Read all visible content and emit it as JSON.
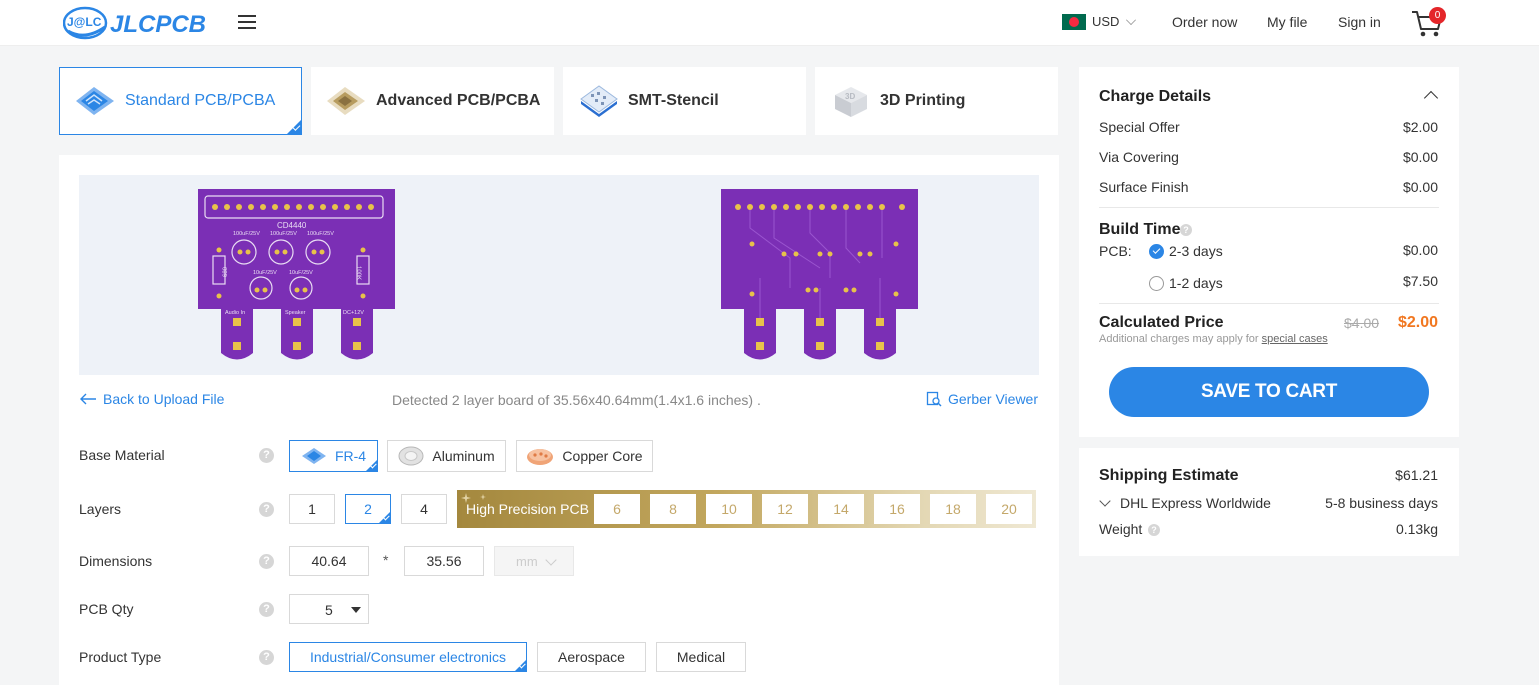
{
  "header": {
    "logo_badge": "J@LC",
    "logo_text": "JLCPCB",
    "currency": "USD",
    "nav": {
      "order_now": "Order now",
      "my_file": "My file",
      "sign_in": "Sign in"
    },
    "cart_count": "0"
  },
  "product_tabs": [
    {
      "label": "Standard PCB/PCBA",
      "active": true
    },
    {
      "label": "Advanced PCB/PCBA",
      "active": false
    },
    {
      "label": "SMT-Stencil",
      "active": false
    },
    {
      "label": "3D Printing",
      "active": false
    }
  ],
  "preview": {
    "top_labels": [
      "CD4440",
      "100uF/25V",
      "100uF/25V",
      "100uF/25V",
      "10uF/25V",
      "10uF/25V",
      "680",
      "100K",
      "Audio In",
      "Speaker",
      "DC+12V"
    ]
  },
  "upload": {
    "back_label": "Back to Upload File",
    "detected_text": "Detected 2 layer board of 35.56x40.64mm(1.4x1.6 inches) .",
    "gerber_label": "Gerber Viewer"
  },
  "form": {
    "help_glyph": "?",
    "base_material": {
      "label": "Base Material",
      "options": [
        "FR-4",
        "Aluminum",
        "Copper Core"
      ],
      "selected": "FR-4"
    },
    "layers": {
      "label": "Layers",
      "options": [
        "1",
        "2",
        "4"
      ],
      "selected": "2",
      "high_precision_label": "High Precision PCB",
      "high_precision_options": [
        "6",
        "8",
        "10",
        "12",
        "14",
        "16",
        "18",
        "20"
      ]
    },
    "dimensions": {
      "label": "Dimensions",
      "width": "40.64",
      "separator": "*",
      "height": "35.56",
      "unit": "mm"
    },
    "pcb_qty": {
      "label": "PCB Qty",
      "value": "5"
    },
    "product_type": {
      "label": "Product Type",
      "options": [
        "Industrial/Consumer electronics",
        "Aerospace",
        "Medical"
      ],
      "selected": "Industrial/Consumer electronics"
    }
  },
  "charge_details": {
    "title": "Charge Details",
    "items": [
      {
        "label": "Special Offer",
        "value": "$2.00"
      },
      {
        "label": "Via Covering",
        "value": "$0.00"
      },
      {
        "label": "Surface Finish",
        "value": "$0.00"
      }
    ],
    "build_time": {
      "title": "Build Time",
      "pcb_label": "PCB:",
      "options": [
        {
          "label": "2-3 days",
          "price": "$0.00",
          "checked": true
        },
        {
          "label": "1-2 days",
          "price": "$7.50",
          "checked": false
        }
      ]
    },
    "calculated_price": {
      "title": "Calculated Price",
      "old_price": "$4.00",
      "new_price": "$2.00",
      "note_prefix": "Additional charges may apply for ",
      "note_link": "special cases"
    },
    "save_button": "SAVE TO CART"
  },
  "shipping": {
    "title": "Shipping Estimate",
    "price": "$61.21",
    "method": "DHL Express Worldwide",
    "time": "5-8 business days",
    "weight_label": "Weight",
    "weight": "0.13kg"
  },
  "colors": {
    "accent": "#2b86e5",
    "price_orange": "#f17720",
    "pcb_purple": "#7b2fb5",
    "gold": "#c4a86a",
    "badge_red": "#e4262a"
  }
}
